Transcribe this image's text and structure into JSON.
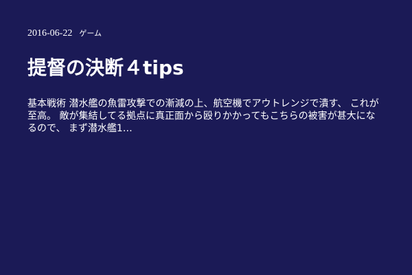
{
  "post": {
    "date": "2016-06-22",
    "category": "ゲーム",
    "title": "提督の決断４tips",
    "excerpt": "基本戦術 潜水艦の魚雷攻撃での漸減の上、航空機でアウトレンジで潰す、 これが至高。 敵が集結してる拠点に真正面から殴りかかってもこちらの被害が甚大になるので、 まず潜水艦1…"
  },
  "colors": {
    "background": "#1b1a56",
    "text": "#ffffff"
  }
}
